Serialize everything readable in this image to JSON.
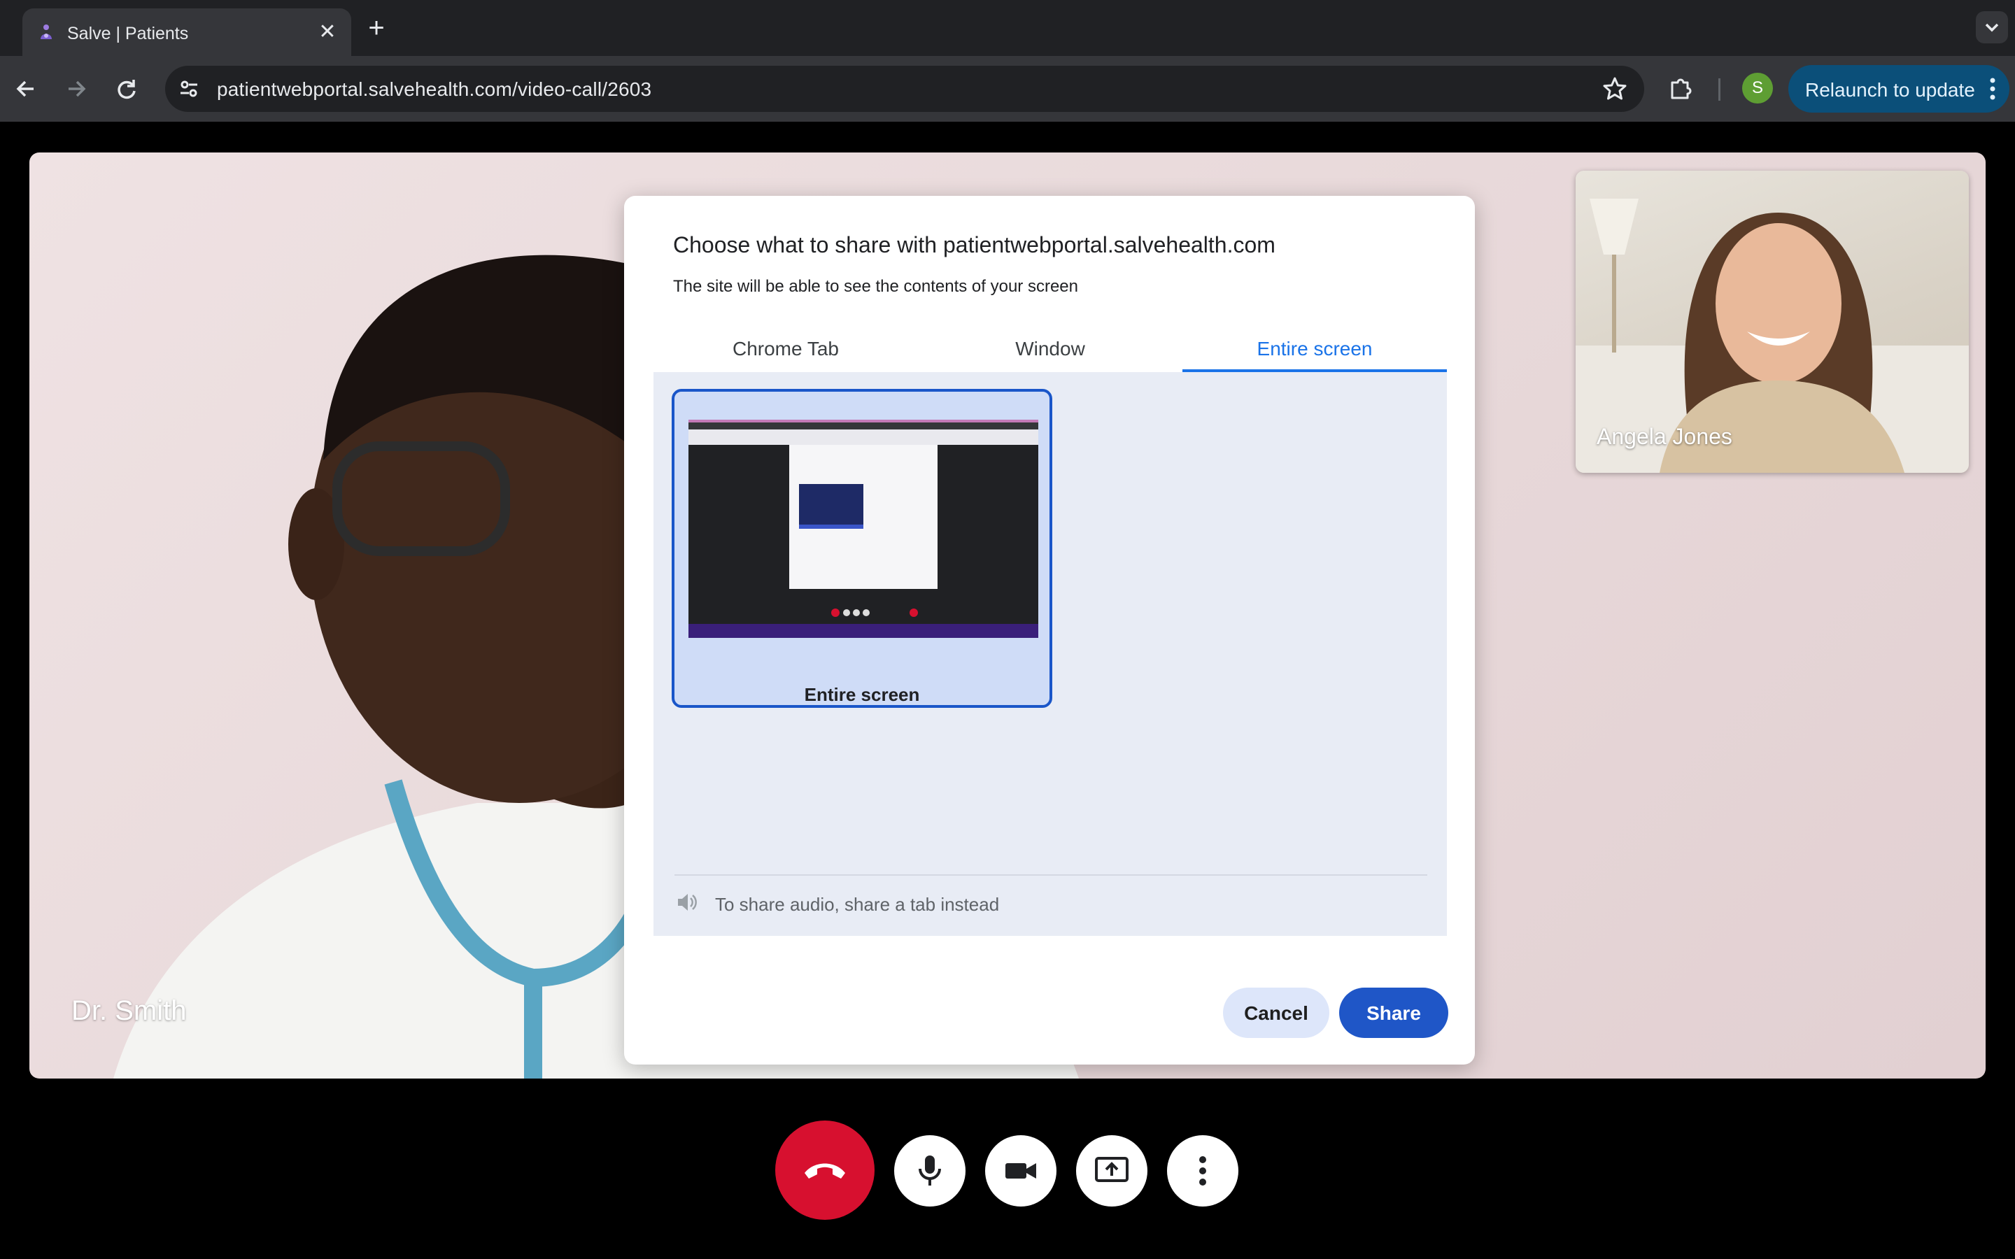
{
  "browser": {
    "tab_title": "Salve | Patients",
    "url": "patientwebportal.salvehealth.com/video-call/2603",
    "profile_initial": "S",
    "relaunch_label": "Relaunch to update"
  },
  "call": {
    "remote_name": "Dr. Smith",
    "self_name": "Angela Jones"
  },
  "share_dialog": {
    "title": "Choose what to share with patientwebportal.salvehealth.com",
    "subtitle": "The site will be able to see the contents of your screen",
    "tabs": [
      {
        "label": "Chrome Tab",
        "active": false
      },
      {
        "label": "Window",
        "active": false
      },
      {
        "label": "Entire screen",
        "active": true
      }
    ],
    "sources": [
      {
        "label": "Entire screen",
        "selected": true
      }
    ],
    "audio_note": "To share audio, share a tab instead",
    "cancel_label": "Cancel",
    "share_label": "Share"
  },
  "controls": {
    "icons": [
      "end-call-icon",
      "microphone-icon",
      "camera-icon",
      "present-screen-icon",
      "more-vert-icon"
    ]
  },
  "colors": {
    "accent": "#1a73e8",
    "share_button": "#1f56c7",
    "end_call": "#d7102f",
    "relaunch": "#0b4f79"
  }
}
